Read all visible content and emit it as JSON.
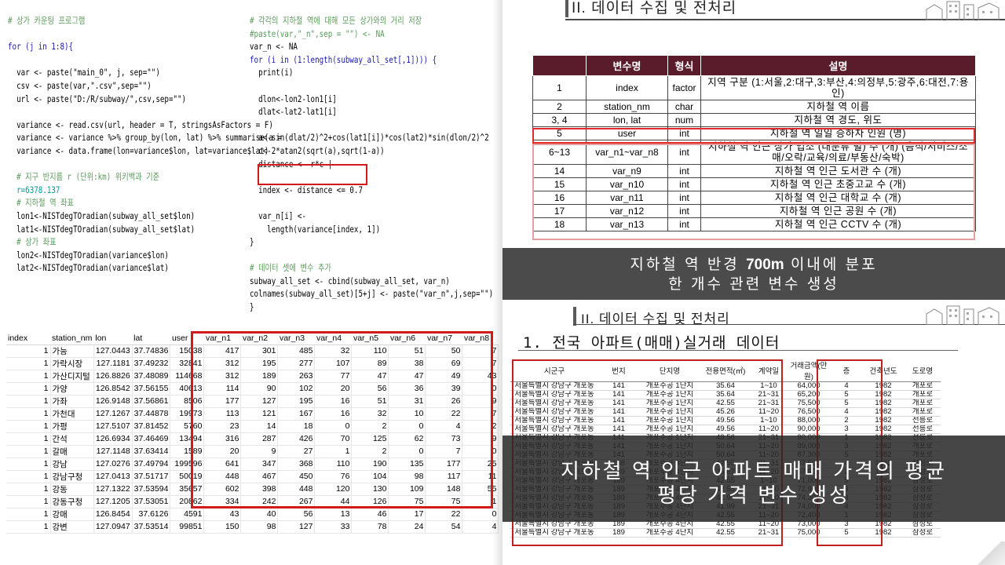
{
  "code": {
    "left_lines": [
      {
        "cls": "c-comment",
        "text": "# 상가 카운팅 프로그램"
      },
      {
        "cls": "c-plain",
        "text": ""
      },
      {
        "cls": "c-kw",
        "text": "for (j in 1:8){"
      },
      {
        "cls": "c-plain",
        "text": ""
      },
      {
        "cls": "c-plain",
        "text": "  var <- paste(\"main_0\", j, sep=\"\")"
      },
      {
        "cls": "c-plain",
        "text": "  csv <- paste(var,\".csv\",sep=\"\")"
      },
      {
        "cls": "c-plain",
        "text": "  url <- paste(\"D:/R/subway/\",csv,sep=\"\")"
      },
      {
        "cls": "c-plain",
        "text": ""
      },
      {
        "cls": "c-plain",
        "text": "  variance <- read.csv(url, header = T, stringsAsFactors = F)"
      },
      {
        "cls": "c-plain",
        "text": "  variance <- variance %>% group_by(lon, lat) %>% summarise(a ="
      },
      {
        "cls": "c-plain",
        "text": "  variance <- data.frame(lon=variance$lon, lat=variance$lat)"
      },
      {
        "cls": "c-plain",
        "text": ""
      },
      {
        "cls": "c-comment",
        "text": "  # 지구 반지름 r (단위:km) 위키백과 기준"
      },
      {
        "cls": "c-num",
        "text": "  r=6378.137"
      },
      {
        "cls": "c-comment",
        "text": "  # 지하철 역 좌표"
      },
      {
        "cls": "c-plain",
        "text": "  lon1<-NISTdegTOradian(subway_all_set$lon)"
      },
      {
        "cls": "c-plain",
        "text": "  lat1<-NISTdegTOradian(subway_all_set$lat)"
      },
      {
        "cls": "c-comment",
        "text": "  # 상가 좌표"
      },
      {
        "cls": "c-plain",
        "text": "  lon2<-NISTdegTOradian(variance$lon)"
      },
      {
        "cls": "c-plain",
        "text": "  lat2<-NISTdegTOradian(variance$lat)"
      }
    ],
    "right_lines": [
      {
        "cls": "c-comment",
        "text": "# 각각의 지하철 역에 대해 모든 상가와의 거리 저장"
      },
      {
        "cls": "c-comment",
        "text": "#paste(var,\"_n\",sep = \"\") <- NA"
      },
      {
        "cls": "c-plain",
        "text": "var_n <- NA"
      },
      {
        "cls": "c-kw",
        "text": "for (i in (1:length(subway_all_set[,1]))) {"
      },
      {
        "cls": "c-plain",
        "text": "  print(i)"
      },
      {
        "cls": "c-plain",
        "text": ""
      },
      {
        "cls": "c-plain",
        "text": "  dlon<-lon2-lon1[i]"
      },
      {
        "cls": "c-plain",
        "text": "  dlat<-lat2-lat1[i]"
      },
      {
        "cls": "c-plain",
        "text": ""
      },
      {
        "cls": "c-plain",
        "text": "  a<-sin(dlat/2)^2+cos(lat1[i])*cos(lat2)*sin(dlon/2)^2"
      },
      {
        "cls": "c-plain",
        "text": "  c<-2*atan2(sqrt(a),sqrt(1-a))"
      },
      {
        "cls": "c-plain",
        "text": "  distance <- r*c |"
      },
      {
        "cls": "c-plain",
        "text": ""
      },
      {
        "cls": "c-plain",
        "text": "  index <- distance <= 0.7"
      },
      {
        "cls": "c-plain",
        "text": ""
      },
      {
        "cls": "c-plain",
        "text": "  var_n[i] <-"
      },
      {
        "cls": "c-plain",
        "text": "    length(variance[index, 1])"
      },
      {
        "cls": "c-plain",
        "text": "}"
      },
      {
        "cls": "c-plain",
        "text": ""
      },
      {
        "cls": "c-comment",
        "text": "# 데이터 셋에 변수 추가"
      },
      {
        "cls": "c-plain",
        "text": "subway_all_set <- cbind(subway_all_set, var_n)"
      },
      {
        "cls": "c-plain",
        "text": "colnames(subway_all_set)[5+j] <- paste(\"var_n\",j,sep=\"\")"
      },
      {
        "cls": "c-plain",
        "text": "}"
      }
    ]
  },
  "data_table": {
    "headers": [
      "index",
      "station_nm",
      "lon",
      "lat",
      "user",
      "var_n1",
      "var_n2",
      "var_n3",
      "var_n4",
      "var_n5",
      "var_n6",
      "var_n7",
      "var_n8"
    ],
    "rows": [
      [
        "1",
        "가능",
        "127.0443",
        "37.74836",
        "15038",
        "417",
        "301",
        "485",
        "32",
        "110",
        "51",
        "50",
        "7"
      ],
      [
        "1",
        "가락시장",
        "127.1181",
        "37.49232",
        "32841",
        "312",
        "195",
        "277",
        "107",
        "89",
        "38",
        "69",
        "7"
      ],
      [
        "1",
        "가산디지털",
        "126.8826",
        "37.48089",
        "114668",
        "312",
        "189",
        "263",
        "77",
        "47",
        "47",
        "49",
        "43"
      ],
      [
        "1",
        "가양",
        "126.8542",
        "37.56155",
        "40613",
        "114",
        "90",
        "102",
        "20",
        "56",
        "36",
        "39",
        "0"
      ],
      [
        "1",
        "가좌",
        "126.9148",
        "37.56861",
        "8506",
        "177",
        "127",
        "195",
        "16",
        "51",
        "31",
        "26",
        "9"
      ],
      [
        "1",
        "가천대",
        "127.1267",
        "37.44878",
        "19973",
        "113",
        "121",
        "167",
        "16",
        "32",
        "10",
        "22",
        "7"
      ],
      [
        "1",
        "가평",
        "127.5107",
        "37.81452",
        "5760",
        "23",
        "14",
        "18",
        "0",
        "2",
        "0",
        "4",
        "2"
      ],
      [
        "1",
        "간석",
        "126.6934",
        "37.46469",
        "13494",
        "316",
        "287",
        "426",
        "70",
        "125",
        "62",
        "73",
        "9"
      ],
      [
        "1",
        "갈매",
        "127.1148",
        "37.63414",
        "1589",
        "20",
        "9",
        "27",
        "1",
        "2",
        "0",
        "7",
        "0"
      ],
      [
        "1",
        "강남",
        "127.0276",
        "37.49794",
        "199596",
        "641",
        "347",
        "368",
        "110",
        "190",
        "135",
        "177",
        "25"
      ],
      [
        "1",
        "강남구청",
        "127.0413",
        "37.51717",
        "50019",
        "448",
        "467",
        "450",
        "76",
        "104",
        "98",
        "117",
        "11"
      ],
      [
        "1",
        "강동",
        "127.1322",
        "37.53594",
        "35657",
        "602",
        "398",
        "448",
        "120",
        "130",
        "109",
        "148",
        "55"
      ],
      [
        "1",
        "강동구청",
        "127.1205",
        "37.53051",
        "20862",
        "334",
        "242",
        "267",
        "44",
        "126",
        "75",
        "75",
        "1"
      ],
      [
        "1",
        "강매",
        "126.8454",
        "37.6126",
        "4591",
        "43",
        "40",
        "56",
        "13",
        "46",
        "17",
        "22",
        "0"
      ],
      [
        "1",
        "강변",
        "127.0947",
        "37.53514",
        "99851",
        "150",
        "98",
        "127",
        "33",
        "78",
        "24",
        "54",
        "4"
      ]
    ]
  },
  "slide1": {
    "section_title": "II. 데이터 수집 및 전처리",
    "table": {
      "headers": [
        "변수명",
        "형식",
        "설명"
      ],
      "rows": [
        {
          "no": "1",
          "name": "index",
          "type": "factor",
          "desc": "지역 구분 (1:서울,2:대구,3:부산,4:의정부,5:광주,6:대전,7:용인)"
        },
        {
          "no": "2",
          "name": "station_nm",
          "type": "char",
          "desc": "지하철 역 이름"
        },
        {
          "no": "3, 4",
          "name": "lon, lat",
          "type": "num",
          "desc": "지하철 역 경도, 위도"
        },
        {
          "no": "5",
          "name": "user",
          "type": "int",
          "desc": "지하철 역 일일 승하차 인원 (명)"
        },
        {
          "no": "6~13",
          "name": "var_n1~var_n8",
          "type": "int",
          "desc": "지하철 역 인근 상가 업소 (대분류 별) 수 (개) (음식/서비스/소매/오락/교육/의료/부동산/숙박)"
        },
        {
          "no": "14",
          "name": "var_n9",
          "type": "int",
          "desc": "지하철 역 인근 도서관 수 (개)"
        },
        {
          "no": "15",
          "name": "var_n10",
          "type": "int",
          "desc": "지하철 역 인근 초중고교 수 (개)"
        },
        {
          "no": "16",
          "name": "var_n11",
          "type": "int",
          "desc": "지하철 역 인근 대학교 수 (개)"
        },
        {
          "no": "17",
          "name": "var_n12",
          "type": "int",
          "desc": "지하철 역 인근 공원 수 (개)"
        },
        {
          "no": "18",
          "name": "var_n13",
          "type": "int",
          "desc": "지하철 역 인근 CCTV 수 (개)"
        }
      ]
    },
    "banner_line1_a": "지하철 역 반경 ",
    "banner_line1_bold": "700m",
    "banner_line1_b": " 이내에 분포",
    "banner_line2": "한 개수 관련 변수 생성"
  },
  "slide2": {
    "section_title": "II. 데이터 수집 및 전처리",
    "subtitle": "1. 전국 아파트(매매)실거래 데이터",
    "table": {
      "headers": [
        "시군구",
        "번지",
        "단지명",
        "전용면적(㎡)",
        "계약일",
        "거래금액(만원)",
        "층",
        "건축년도",
        "도로명"
      ],
      "rows": [
        [
          "서울특별시 강남구 개포동",
          "141",
          "개포주공 1단지",
          "35.64",
          "1~10",
          "64,000",
          "4",
          "1982",
          "개포로"
        ],
        [
          "서울특별시 강남구 개포동",
          "141",
          "개포주공 1단지",
          "35.64",
          "21~31",
          "65,200",
          "5",
          "1982",
          "개포로"
        ],
        [
          "서울특별시 강남구 개포동",
          "141",
          "개포주공 1단지",
          "42.55",
          "21~31",
          "75,500",
          "5",
          "1982",
          "개포로"
        ],
        [
          "서울특별시 강남구 개포동",
          "141",
          "개포주공 1단지",
          "45.26",
          "11~20",
          "76,500",
          "4",
          "1982",
          "개포로"
        ],
        [
          "서울특별시 강남구 개포동",
          "141",
          "개포주공 1단지",
          "49.56",
          "1~10",
          "88,000",
          "2",
          "1982",
          "선릉로"
        ],
        [
          "서울특별시 강남구 개포동",
          "141",
          "개포주공 1단지",
          "49.56",
          "11~20",
          "90,000",
          "3",
          "1982",
          "선릉로"
        ],
        [
          "서울특별시 강남구 개포동",
          "141",
          "개포주공 1단지",
          "49.56",
          "21~31",
          "90,000",
          "1",
          "1982",
          "선릉로"
        ],
        [
          "서울특별시 강남구 개포동",
          "141",
          "개포주공 1단지",
          "50.64",
          "11~20",
          "89,000",
          "3",
          "1982",
          "개포로"
        ],
        [
          "서울특별시 강남구 개포동",
          "141",
          "개포주공 1단지",
          "50.64",
          "11~20",
          "87,300",
          "5",
          "1982",
          "개포로"
        ],
        [
          "서울특별시 강남구 개포동",
          "138",
          "개포주공 3단지",
          "42.55",
          "21~31",
          "87,500",
          "4",
          "1982",
          "삼성로"
        ],
        [
          "서울특별시 강남구 개포동",
          "189",
          "개포주공 4단지",
          "35.87",
          "11~20",
          "67,500",
          "2",
          "1982",
          "삼성로"
        ],
        [
          "서울특별시 강남구 개포동",
          "189",
          "개포주공 4단지",
          "42.55",
          "1~10",
          "71,000",
          "5",
          "1982",
          "삼성로"
        ],
        [
          "서울특별시 강남구 개포동",
          "189",
          "개포주공 4단지",
          "42.55",
          "11~20",
          "72,900",
          "3",
          "1982",
          "삼성로"
        ],
        [
          "서울특별시 강남구 개포동",
          "189",
          "개포주공 4단지",
          "41.99",
          "11~20",
          "74,300",
          "3",
          "1982",
          "삼성로"
        ],
        [
          "서울특별시 강남구 개포동",
          "189",
          "개포주공 4단지",
          "41.99",
          "21~31",
          "74,000",
          "4",
          "1982",
          "삼성로"
        ],
        [
          "서울특별시 강남구 개포동",
          "189",
          "개포주공 4단지",
          "42.55",
          "11~20",
          "72,400",
          "1",
          "1982",
          "삼성로"
        ],
        [
          "서울특별시 강남구 개포동",
          "189",
          "개포주공 4단지",
          "42.55",
          "11~20",
          "73,000",
          "3",
          "1982",
          "삼성로"
        ],
        [
          "서울특별시 강남구 개포동",
          "189",
          "개포주공 4단지",
          "42.55",
          "21~31",
          "75,000",
          "5",
          "1982",
          "삼성로"
        ]
      ]
    },
    "banner_line1": "지하철 역 인근 아파트 매매 가격의 평균",
    "banner_line2": "평당 가격 변수 생성"
  },
  "colors": {
    "highlight_red": "#d21a1a",
    "table_header": "#5a1b2a",
    "banner_bg": "#323232"
  }
}
